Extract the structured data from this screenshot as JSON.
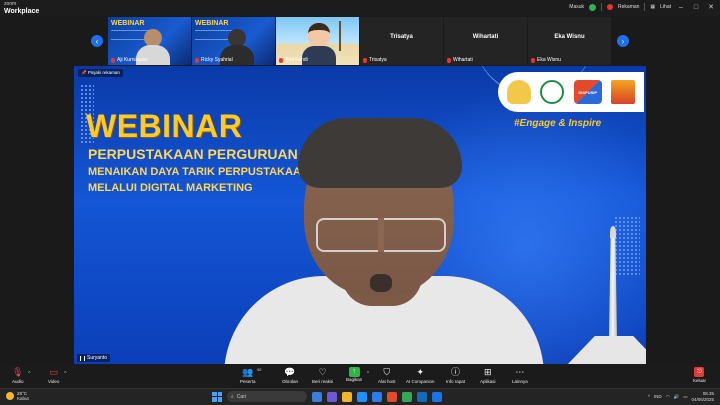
{
  "app": {
    "brand_top": "zoom",
    "brand_bottom": "Workplace"
  },
  "titlebar": {
    "signin_label": "Masuk",
    "recording_label": "Rekaman",
    "view_label": "Lihat",
    "icons": [
      "shield-check-icon",
      "record-icon",
      "grid-view-icon"
    ],
    "window_controls": [
      "–",
      "□",
      "✕"
    ]
  },
  "thumbnails": [
    {
      "name": "Aji Kurniawan",
      "type": "slide-cam",
      "muted": true
    },
    {
      "name": "Ricky Syahrial",
      "type": "slide-cam",
      "muted": true
    },
    {
      "name": "Ardi Fandi",
      "type": "avatar",
      "muted": true
    },
    {
      "name": "Trisatya",
      "type": "name-only",
      "muted": true
    },
    {
      "name": "Wihartati",
      "type": "name-only",
      "muted": true
    },
    {
      "name": "Eka Wisnu",
      "type": "name-only",
      "muted": true
    }
  ],
  "thumb_slide_text": "WEBINAR",
  "main_share": {
    "pin_label": "Pinjaki rekaman",
    "webinar": "WEBINAR",
    "line1": "PERPUSTAKAAN PERGURUAN T",
    "line2": "MENAIKAN DAYA TARIK PERPUSTAKAA",
    "line3": "MELALUI DIGITAL MARKETING",
    "tagline": "#Engage & Inspire",
    "logo_text": "DISPUSIP",
    "speaker_name": "Suryanto"
  },
  "toolbar": {
    "audio": "Audio",
    "video": "Video",
    "participants": "Peserta",
    "participants_count": "92",
    "chat": "Obrolan",
    "reactions": "Beri reaksi",
    "share": "Bagikan",
    "host_tools": "Alat host",
    "ai_companion": "AI Companion",
    "meeting_info": "Info rapat",
    "apps": "Aplikasi",
    "more": "Lainnya",
    "leave": "Keluar"
  },
  "taskbar": {
    "temperature": "28°C",
    "weather": "Kabut",
    "search_placeholder": "Cari",
    "lang": "IND",
    "time": "08.35",
    "date": "04/06/2025"
  },
  "colors": {
    "accent": "#1f6feb",
    "slide_blue": "#1456d6",
    "slide_yellow": "#ffc928",
    "leave_red": "#e03b3b",
    "share_green": "#2fb34a"
  }
}
